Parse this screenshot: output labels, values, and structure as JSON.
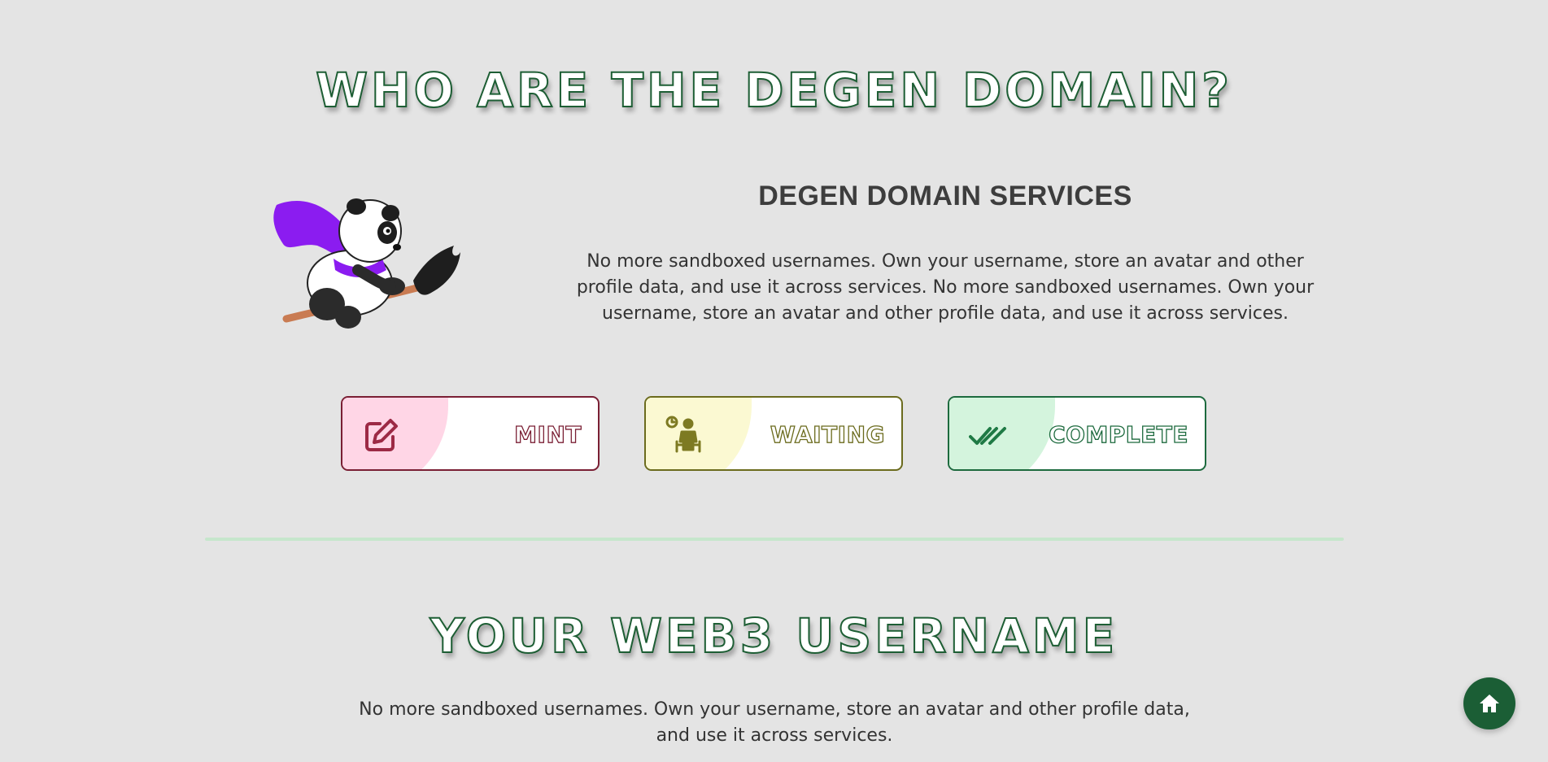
{
  "sections": {
    "about": {
      "title": "WHO ARE THE DEGEN DOMAIN?",
      "services_heading": "DEGEN DOMAIN SERVICES",
      "services_text": "No more sandboxed usernames. Own your username, store an avatar and other profile data, and use it across services. No more sandboxed usernames. Own your username, store an avatar and other profile data, and use it across services.",
      "mascot_icon": "panda-on-broom-icon"
    },
    "status_cards": [
      {
        "label": "MINT",
        "icon": "edit-icon",
        "accent": "#7a1f34",
        "tint": "#ffd6e6"
      },
      {
        "label": "WAITING",
        "icon": "waiting-person-icon",
        "accent": "#6b6b1d",
        "tint": "#fbf9d2"
      },
      {
        "label": "COMPLETE",
        "icon": "double-check-icon",
        "accent": "#1d6a3e",
        "tint": "#d4f4dd"
      }
    ],
    "username": {
      "title": "YOUR WEB3 USERNAME",
      "text": "No more sandboxed usernames. Own your username, store an avatar and other profile data, and use it across services."
    }
  },
  "home_button": {
    "icon": "home-icon",
    "color": "#1b5e35"
  },
  "colors": {
    "background": "#e4e4e4",
    "title_outline": "#1d5e34",
    "divider": "#c6e6cc"
  }
}
